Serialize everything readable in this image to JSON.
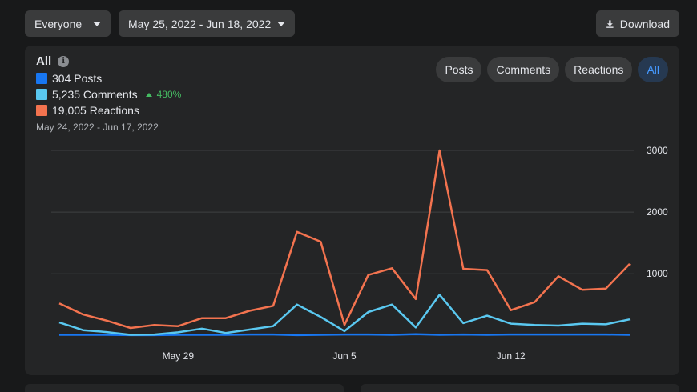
{
  "toolbar": {
    "audience": "Everyone",
    "date_range": "May 25, 2022 - Jun 18, 2022",
    "download_label": "Download"
  },
  "legend": {
    "title": "All",
    "posts": "304 Posts",
    "comments": "5,235 Comments",
    "comments_delta": "480%",
    "reactions": "19,005 Reactions",
    "range": "May 24, 2022 - Jun 17, 2022"
  },
  "tabs": [
    {
      "label": "Posts",
      "active": false
    },
    {
      "label": "Comments",
      "active": false
    },
    {
      "label": "Reactions",
      "active": false
    },
    {
      "label": "All",
      "active": true
    }
  ],
  "colors": {
    "posts": "#1877f2",
    "comments": "#5ac8f0",
    "reactions": "#f3734f",
    "active_tab": "#4599ff"
  },
  "chart_data": {
    "type": "line",
    "x": [
      "May 24",
      "May 25",
      "May 26",
      "May 27",
      "May 28",
      "May 29",
      "May 30",
      "May 31",
      "Jun 1",
      "Jun 2",
      "Jun 3",
      "Jun 4",
      "Jun 5",
      "Jun 6",
      "Jun 7",
      "Jun 8",
      "Jun 9",
      "Jun 10",
      "Jun 11",
      "Jun 12",
      "Jun 13",
      "Jun 14",
      "Jun 15",
      "Jun 16",
      "Jun 17"
    ],
    "x_ticks": [
      {
        "label": "May 29",
        "x": "May 29"
      },
      {
        "label": "Jun 5",
        "x": "Jun 5"
      },
      {
        "label": "Jun 12",
        "x": "Jun 12"
      }
    ],
    "y_ticks": [
      1000,
      2000,
      3000
    ],
    "ylim": [
      -100,
      3000
    ],
    "grid": true,
    "series": [
      {
        "name": "Posts",
        "color": "#1877f2",
        "values": [
          10,
          10,
          10,
          5,
          5,
          10,
          10,
          10,
          15,
          15,
          5,
          10,
          15,
          15,
          10,
          20,
          10,
          15,
          10,
          15,
          15,
          15,
          15,
          15,
          10
        ]
      },
      {
        "name": "Comments",
        "color": "#5ac8f0",
        "values": [
          210,
          85,
          55,
          10,
          15,
          50,
          110,
          40,
          95,
          150,
          500,
          300,
          70,
          380,
          500,
          130,
          660,
          200,
          320,
          190,
          170,
          160,
          190,
          180,
          260
        ]
      },
      {
        "name": "Reactions",
        "color": "#f3734f",
        "values": [
          520,
          340,
          240,
          120,
          170,
          150,
          280,
          280,
          400,
          480,
          1680,
          1520,
          170,
          980,
          1090,
          590,
          3000,
          1080,
          1060,
          410,
          540,
          960,
          740,
          760,
          1160
        ]
      }
    ]
  }
}
